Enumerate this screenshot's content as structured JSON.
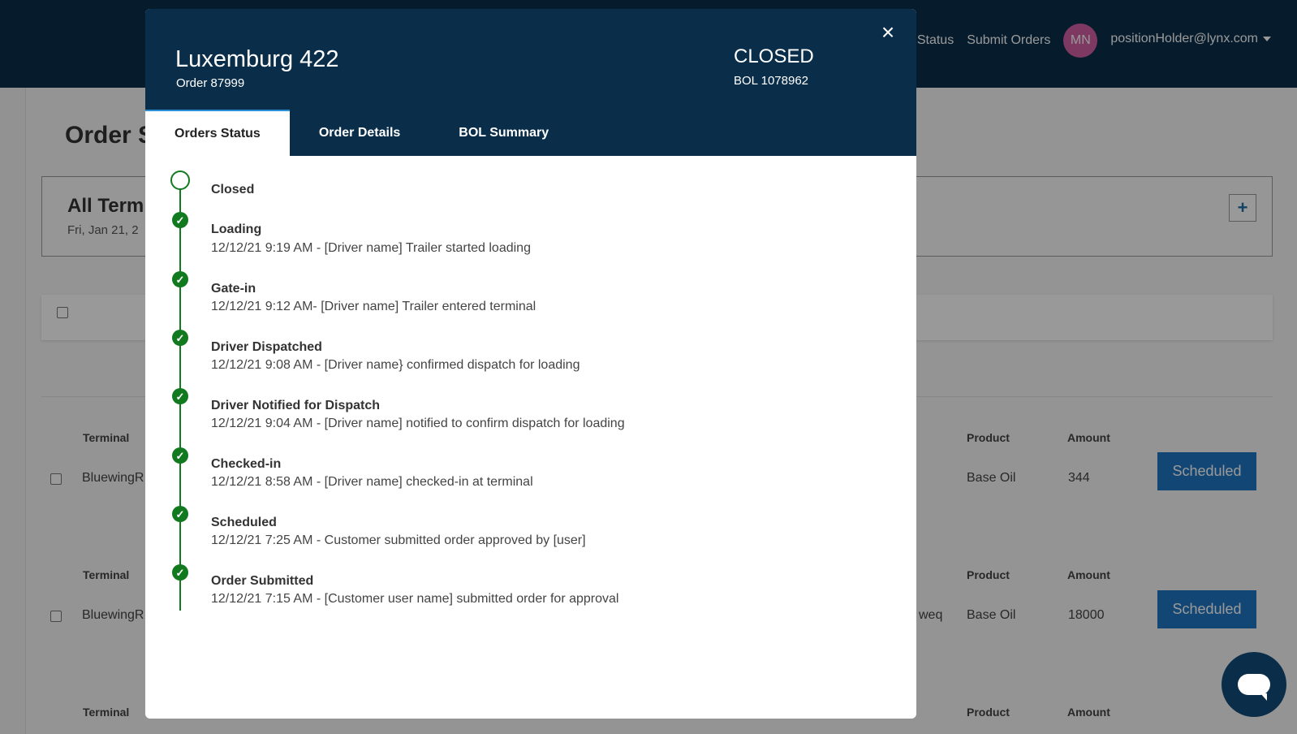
{
  "header": {
    "nav_status": "Status",
    "nav_submit_orders": "Submit Orders",
    "avatar_initials": "MN",
    "user_email": "positionHolder@lynx.com"
  },
  "page": {
    "title": "Order S",
    "terminal_title": "All Term",
    "terminal_date": "Fri, Jan 21, 2",
    "add_button": "+"
  },
  "orders": {
    "columns": {
      "terminal": "Terminal",
      "product": "Product",
      "amount": "Amount"
    },
    "rows": [
      {
        "terminal": "BluewingR",
        "extra": "",
        "product": "Base Oil",
        "amount": "344",
        "status": "Scheduled"
      },
      {
        "terminal": "BluewingR",
        "extra": "weq",
        "product": "Base Oil",
        "amount": "18000",
        "status": "Scheduled"
      },
      {
        "terminal": "",
        "extra": "",
        "product": "",
        "amount": "",
        "status": ""
      }
    ]
  },
  "modal": {
    "title": "Luxemburg 422",
    "order_number": "Order 87999",
    "status": "CLOSED",
    "bol": "BOL 1078962",
    "close_icon": "close-icon",
    "tabs": [
      {
        "label": "Orders Status",
        "active": true
      },
      {
        "label": "Order Details",
        "active": false
      },
      {
        "label": "BOL Summary",
        "active": false
      }
    ],
    "timeline": [
      {
        "title": "Closed",
        "detail": "",
        "state": "current"
      },
      {
        "title": "Loading",
        "detail": "12/12/21 9:19 AM - [Driver name] Trailer started loading",
        "state": "done"
      },
      {
        "title": "Gate-in",
        "detail": "12/12/21 9:12 AM- [Driver name] Trailer entered terminal",
        "state": "done"
      },
      {
        "title": "Driver Dispatched",
        "detail": "12/12/21 9:08 AM - [Driver name} confirmed dispatch for loading",
        "state": "done"
      },
      {
        "title": "Driver Notified for Dispatch",
        "detail": "12/12/21 9:04 AM - [Driver name] notified to confirm dispatch for loading",
        "state": "done"
      },
      {
        "title": "Checked-in",
        "detail": "12/12/21 8:58 AM - [Driver name] checked-in at terminal",
        "state": "done"
      },
      {
        "title": "Scheduled",
        "detail": "12/12/21 7:25 AM - Customer submitted order approved by [user]",
        "state": "done"
      },
      {
        "title": "Order Submitted",
        "detail": "12/12/21 7:15 AM - [Customer user name] submitted order for approval",
        "state": "done"
      }
    ]
  },
  "colors": {
    "navy": "#0a2e4a",
    "success_green": "#117a1f",
    "button_blue": "#1f77c4",
    "avatar_pink": "#d35fa5"
  }
}
